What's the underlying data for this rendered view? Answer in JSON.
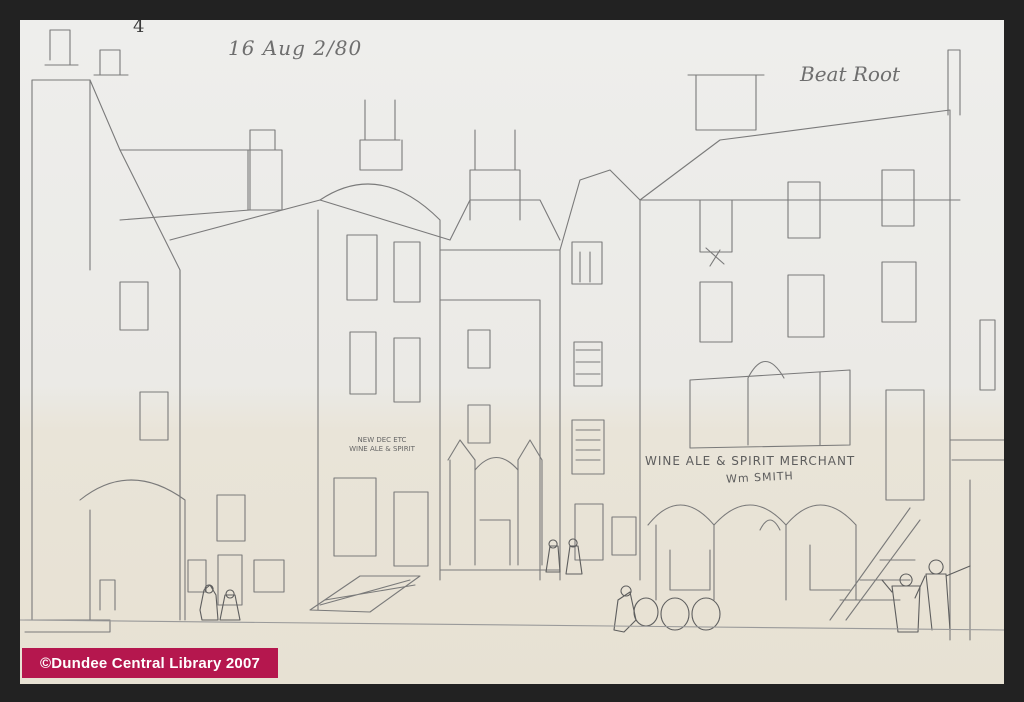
{
  "image": {
    "subject": "pencil-sketch"
  },
  "annotations": {
    "sheet_number": "4",
    "date": "16 Aug 2/80",
    "corner_note": "Beat Root"
  },
  "signs": {
    "shop_sign_line1": "NEW DEC ETC",
    "shop_sign_line2": "WINE ALE & SPIRIT",
    "merchant": "WINE ALE & SPIRIT MERCHANT",
    "proprietor": "Wm SMITH"
  },
  "credit": "©Dundee Central Library 2007",
  "colors": {
    "frame": "#222222",
    "paper": "#ecebe6",
    "pencil": "#7a7a7a",
    "credit_bg": "#b5174e",
    "credit_text": "#ffffff"
  }
}
